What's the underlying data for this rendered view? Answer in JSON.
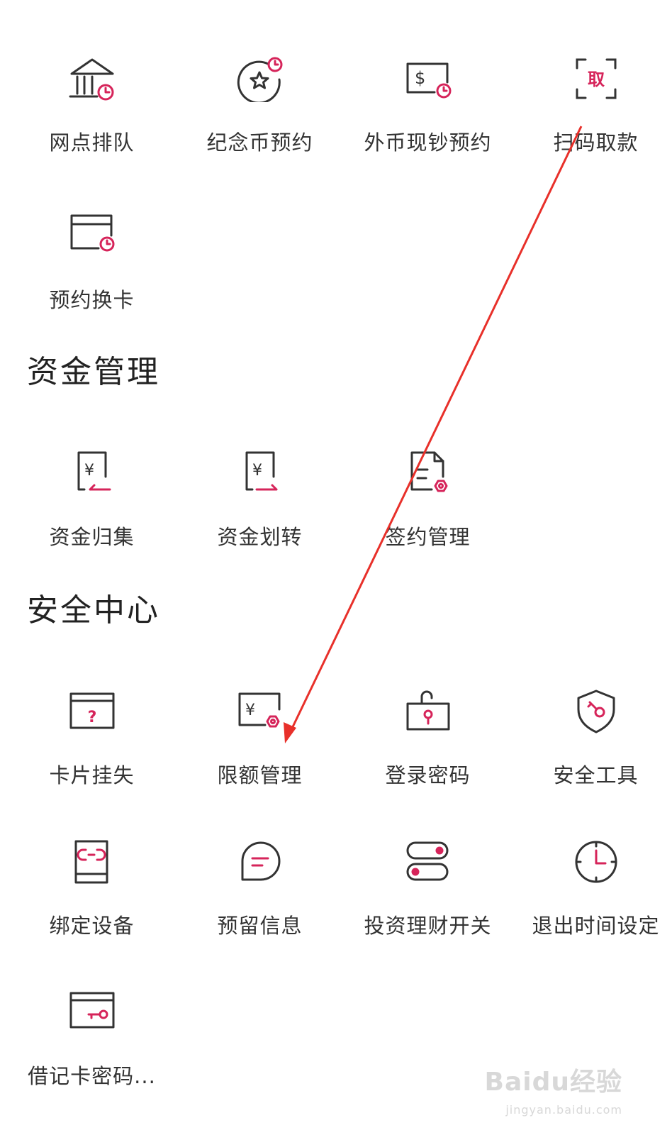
{
  "colors": {
    "accent": "#d6245a",
    "stroke": "#333333",
    "annotation": "#e8302a"
  },
  "sections": {
    "funds_title": "资金管理",
    "security_title": "安全中心"
  },
  "reservations": {
    "items": [
      {
        "label": "网点排队",
        "icon": "bank-clock-icon"
      },
      {
        "label": "纪念币预约",
        "icon": "coin-star-icon"
      },
      {
        "label": "外币现钞预约",
        "icon": "dollar-bill-icon"
      },
      {
        "label": "扫码取款",
        "icon": "scan-withdraw-icon"
      },
      {
        "label": "预约换卡",
        "icon": "card-clock-icon"
      }
    ]
  },
  "funds": {
    "items": [
      {
        "label": "资金归集",
        "icon": "fund-collect-icon"
      },
      {
        "label": "资金划转",
        "icon": "fund-transfer-icon"
      },
      {
        "label": "签约管理",
        "icon": "contract-settings-icon"
      }
    ]
  },
  "security": {
    "items": [
      {
        "label": "卡片挂失",
        "icon": "card-question-icon"
      },
      {
        "label": "限额管理",
        "icon": "limit-settings-icon"
      },
      {
        "label": "登录密码",
        "icon": "lock-icon"
      },
      {
        "label": "安全工具",
        "icon": "shield-key-icon"
      },
      {
        "label": "绑定设备",
        "icon": "phone-link-icon"
      },
      {
        "label": "预留信息",
        "icon": "message-icon"
      },
      {
        "label": "投资理财开关",
        "icon": "toggle-icon"
      },
      {
        "label": "退出时间设定",
        "icon": "clock-icon"
      },
      {
        "label": "借记卡密码...",
        "icon": "card-key-icon"
      }
    ]
  },
  "scan_badge_text": "取",
  "watermark": {
    "brand": "Baidu经验",
    "url": "jingyan.baidu.com"
  }
}
